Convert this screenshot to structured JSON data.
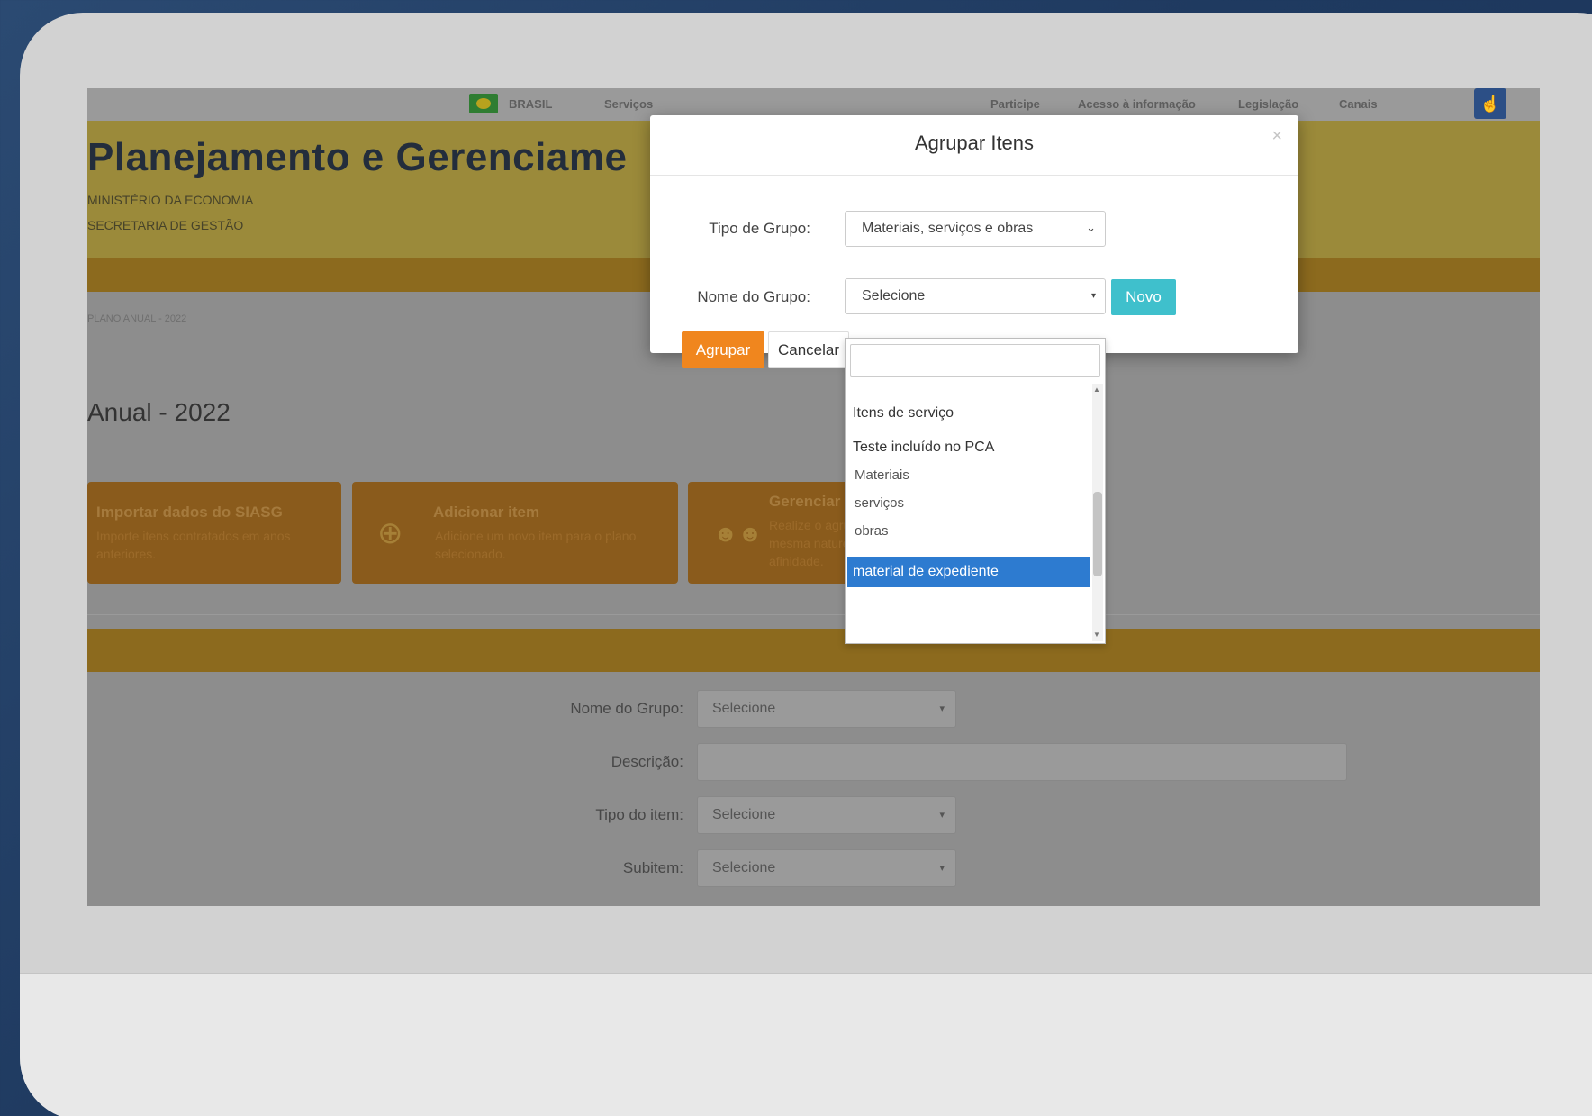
{
  "gov_bar": {
    "country": "BRASIL",
    "services": "Serviços",
    "links": [
      "Participe",
      "Acesso à informação",
      "Legislação",
      "Canais"
    ]
  },
  "header": {
    "title": "Planejamento e Gerenciame",
    "ministry": "MINISTÉRIO DA ECONOMIA",
    "secretariat": "SECRETARIA DE GESTÃO"
  },
  "breadcrumb": "PLANO ANUAL - 2022",
  "page_title": "Anual - 2022",
  "cards": [
    {
      "title": "Importar dados do SIASG",
      "desc": "Importe itens contratados em anos anteriores.",
      "icon": "download-icon"
    },
    {
      "title": "Adicionar item",
      "desc": "Adicione um novo item para o plano selecionado.",
      "icon": "plus-circle-icon"
    },
    {
      "title": "Gerenciar",
      "desc": "Realize o agrupamento de itens de mesma natureza, semelhança ou afinidade.",
      "icon": "users-group-icon"
    }
  ],
  "form": {
    "nome_grupo_label": "Nome do Grupo:",
    "nome_grupo_value": "Selecione",
    "descricao_label": "Descrição:",
    "tipo_item_label": "Tipo do item:",
    "tipo_item_value": "Selecione",
    "subitem_label": "Subitem:",
    "subitem_value": "Selecione"
  },
  "modal": {
    "title": "Agrupar Itens",
    "close": "×",
    "tipo_grupo_label": "Tipo de Grupo:",
    "tipo_grupo_value": "Materiais, serviços e obras",
    "nome_grupo_label": "Nome do Grupo:",
    "nome_grupo_value": "Selecione",
    "novo_label": "Novo",
    "agrupar_label": "Agrupar",
    "cancelar_label": "Cancelar"
  },
  "dropdown": {
    "items": [
      "Itens de serviço",
      "Teste incluído no PCA",
      "Materiais",
      "serviços",
      "obras"
    ],
    "selected": "material de expediente"
  },
  "colors": {
    "accent_orange": "#f0861e",
    "novo_teal": "#3fc0cc",
    "selection_blue": "#2d7bd0",
    "background_navy": "#1f3a60"
  }
}
